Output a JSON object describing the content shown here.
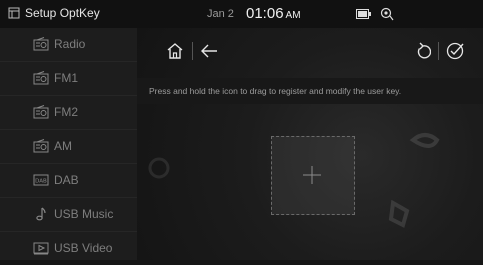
{
  "status_bar": {
    "app_title": "Setup OptKey",
    "date": "Jan 2",
    "time": "01:06",
    "ampm": "AM"
  },
  "sidebar": {
    "items": [
      {
        "label": "Radio",
        "icon": "radio-icon"
      },
      {
        "label": "FM1",
        "icon": "radio-icon"
      },
      {
        "label": "FM2",
        "icon": "radio-icon"
      },
      {
        "label": "AM",
        "icon": "radio-icon"
      },
      {
        "label": "DAB",
        "icon": "dab-icon"
      },
      {
        "label": "USB Music",
        "icon": "music-note-icon"
      },
      {
        "label": "USB Video",
        "icon": "video-icon"
      }
    ]
  },
  "main": {
    "instruction": "Press and hold the icon to drag to register and modify the user key."
  },
  "colors": {
    "background": "#151515",
    "sidebar": "#1d1d1d",
    "text_dim": "#7e7e7e",
    "text_bright": "#f0f0f0"
  }
}
